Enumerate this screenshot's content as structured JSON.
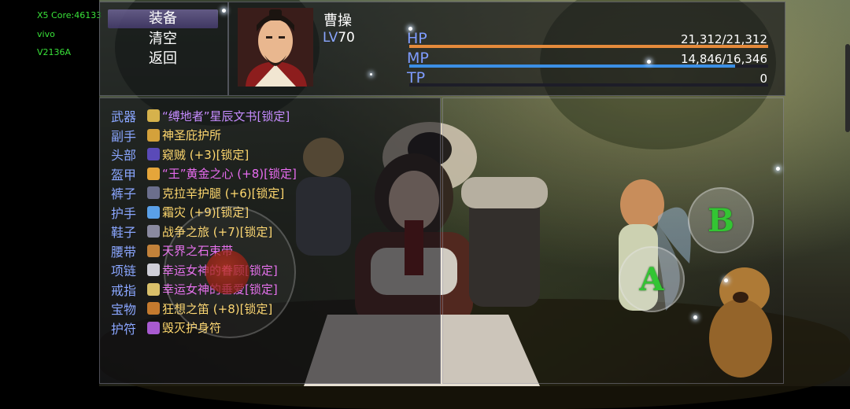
{
  "debug": {
    "core": "X5 Core:46133",
    "vendor": "vivo",
    "model": "V2136A"
  },
  "menu": {
    "items": [
      {
        "label": "装备",
        "selected": true
      },
      {
        "label": "清空",
        "selected": false
      },
      {
        "label": "返回",
        "selected": false
      }
    ]
  },
  "character": {
    "name": "曹操",
    "level_label": "LV",
    "level": "70"
  },
  "stats": {
    "hp": {
      "label": "HP",
      "value": "21,312/21,312",
      "fraction": 1.0,
      "color": "#e58a3b"
    },
    "mp": {
      "label": "MP",
      "value": "14,846/16,346",
      "fraction": 0.908,
      "color": "#3b8fe5"
    },
    "tp": {
      "label": "TP",
      "value": "0",
      "fraction": 0.0,
      "color": "#555577"
    }
  },
  "equipment": [
    {
      "slot": "武器",
      "item": "“缚地者”星辰文书[锁定]",
      "color": "#c68cff",
      "icon": "book-icon",
      "icon_color": "#d6b24c"
    },
    {
      "slot": "副手",
      "item": "神圣庇护所",
      "color": "#ffd86e",
      "icon": "medallion-icon",
      "icon_color": "#d4a13b"
    },
    {
      "slot": "头部",
      "item": "窥贼 (+3)[锁定]",
      "color": "#ffd86e",
      "icon": "hood-icon",
      "icon_color": "#5a4ab8"
    },
    {
      "slot": "盔甲",
      "item": "“王”黄金之心 (+8)[锁定]",
      "color": "#e86cf0",
      "icon": "armor-icon",
      "icon_color": "#e5a53a"
    },
    {
      "slot": "裤子",
      "item": "克拉辛护腿 (+6)[锁定]",
      "color": "#ffd86e",
      "icon": "greaves-icon",
      "icon_color": "#6b6f8c"
    },
    {
      "slot": "护手",
      "item": "霜灾 (+9)[锁定]",
      "color": "#ffd86e",
      "icon": "gauntlet-icon",
      "icon_color": "#5aa0e8"
    },
    {
      "slot": "鞋子",
      "item": "战争之旅 (+7)[锁定]",
      "color": "#ffd86e",
      "icon": "boots-icon",
      "icon_color": "#8a8aa0"
    },
    {
      "slot": "腰带",
      "item": "天界之石束带",
      "color": "#e86cf0",
      "icon": "belt-icon",
      "icon_color": "#c2823a"
    },
    {
      "slot": "项链",
      "item": "幸运女神的眷顾[锁定]",
      "color": "#e86cf0",
      "icon": "necklace-icon",
      "icon_color": "#cfcfd8"
    },
    {
      "slot": "戒指",
      "item": "幸运女神的垂爱[锁定]",
      "color": "#e86cf0",
      "icon": "ring-icon",
      "icon_color": "#d9c06a"
    },
    {
      "slot": "宝物",
      "item": "狂想之笛 (+8)[锁定]",
      "color": "#ffd86e",
      "icon": "flute-icon",
      "icon_color": "#c47a2e"
    },
    {
      "slot": "护符",
      "item": "毁灭护身符",
      "color": "#ffd86e",
      "icon": "amulet-icon",
      "icon_color": "#a85ad0"
    }
  ],
  "buttons": {
    "a_label": "A",
    "b_label": "B"
  }
}
